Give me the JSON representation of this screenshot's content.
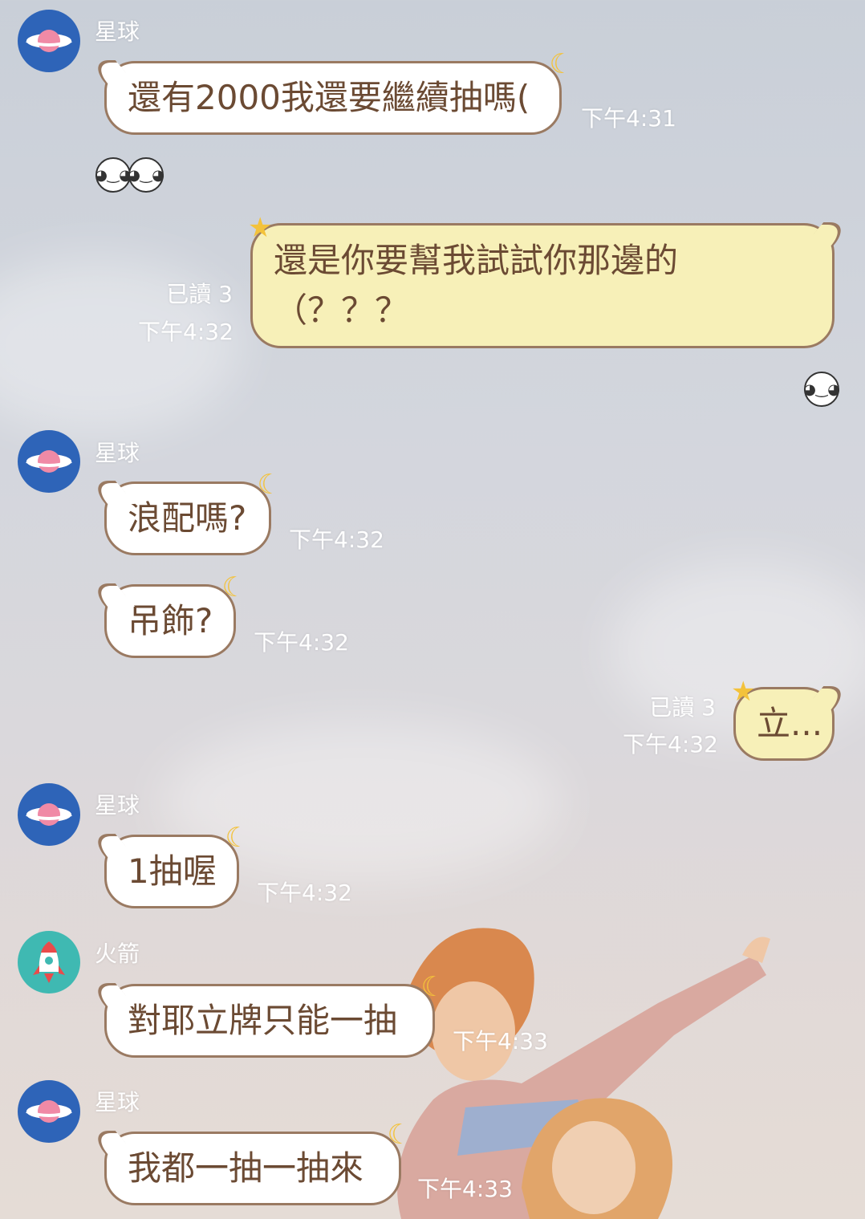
{
  "messages": [
    {
      "sender": "星球",
      "text": "還有2000我還要繼續抽嗎(",
      "time": "下午4:31"
    },
    {
      "sticker": "laughing-face-stickers"
    },
    {
      "mine": true,
      "read": "已讀 3",
      "time": "下午4:32",
      "text_line1": "還是你要幫我試試你那邊的",
      "text_line2": "（？？？"
    },
    {
      "sticker": "laughing-face-sticker"
    },
    {
      "sender": "星球",
      "text": "浪配嗎?",
      "time": "下午4:32"
    },
    {
      "text": "吊飾?",
      "time": "下午4:32"
    },
    {
      "mine": true,
      "read": "已讀 3",
      "time": "下午4:32",
      "text": "立..."
    },
    {
      "sender": "星球",
      "text": "1抽喔",
      "time": "下午4:32"
    },
    {
      "sender": "火箭",
      "text": "對耶立牌只能一抽",
      "time": "下午4:33"
    },
    {
      "sender": "星球",
      "text": "我都一抽一抽來",
      "time": "下午4:33"
    }
  ],
  "colors": {
    "bubble_border": "#9a7a62",
    "bubble_text": "#6b4a33",
    "mine_bubble_bg": "#f7f0b8",
    "planet_avatar_bg": "#2e64b8",
    "rocket_avatar_bg": "#3fb9b2"
  },
  "icons": [
    "planet-icon",
    "rocket-icon",
    "moon-icon",
    "star-icon",
    "laughing-face-icon"
  ]
}
